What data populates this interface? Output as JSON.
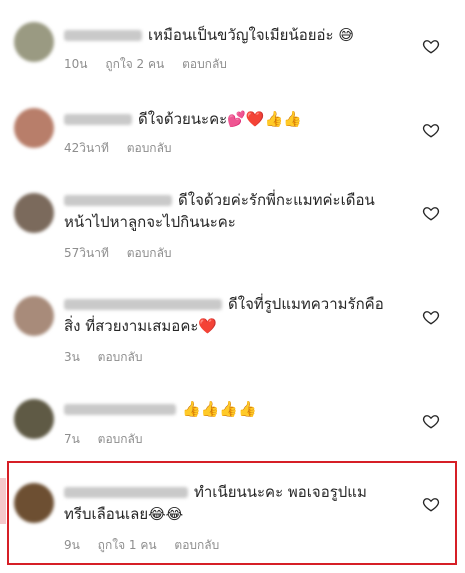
{
  "comments": [
    {
      "username": "jensiri_ink",
      "text": "เหมือนเป็นขวัญใจเมียน้อยอ่ะ 😅",
      "time": "10น",
      "likes": "ถูกใจ 2 คน",
      "reply": "ตอบกลับ",
      "avatar_color": "#9a9a82"
    },
    {
      "username": "fabnarak",
      "text": "ดีใจด้วยนะคะ💕❤️👍👍",
      "time": "42วินาที",
      "likes": "",
      "reply": "ตอบกลับ",
      "avatar_color": "#b87e6a"
    },
    {
      "username": "nkmysurengkh",
      "text": "ดีใจด้วยค่ะรักพี่กะแมทค่ะเดือน หน้าไปหาลูกจะไปกินนะคะ",
      "time": "57วินาที",
      "likes": "",
      "reply": "ตอบกลับ",
      "avatar_color": "#7b6a5c"
    },
    {
      "username": "nomchitkhanthong",
      "text": "ดีใจที่รูปแมทความรักคือสิ่ง ที่สวยงามเสมอคะ❤️",
      "time": "3น",
      "likes": "",
      "reply": "ตอบกลับ",
      "avatar_color": "#a88b7a"
    },
    {
      "username": "park_siriuak65",
      "text": "👍👍👍👍",
      "time": "7น",
      "likes": "",
      "reply": "ตอบกลับ",
      "avatar_color": "#5f5a45"
    },
    {
      "username": "dandaranirache",
      "text": "ทำเนียนนะคะ พอเจอรูปแม ทรีบเลือนเลย😂😂",
      "time": "9น",
      "likes": "ถูกใจ 1 คน",
      "reply": "ตอบกลับ",
      "avatar_color": "#6d4f32"
    }
  ],
  "colors": {
    "highlight": "#d61f26",
    "meta": "#8e8e8e",
    "text": "#262626"
  }
}
